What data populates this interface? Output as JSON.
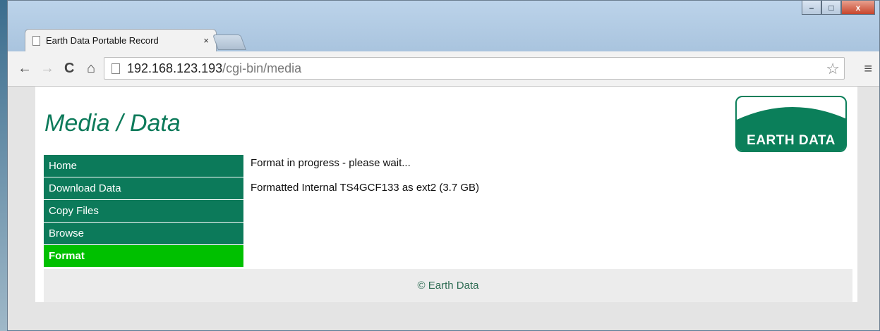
{
  "browser": {
    "tab_title": "Earth Data Portable Record",
    "tab_close": "×",
    "url_host": "192.168.123.193",
    "url_path": "/cgi-bin/media",
    "back_glyph": "←",
    "forward_glyph": "→",
    "reload_glyph": "C",
    "home_glyph": "⌂",
    "star_glyph": "☆",
    "menu_glyph": "≡",
    "minimize_glyph": "–",
    "maximize_glyph": "□",
    "close_glyph": "x"
  },
  "page": {
    "heading": "Media / Data",
    "logo_text": "EARTH DATA",
    "sidebar": [
      {
        "label": "Home",
        "active": false
      },
      {
        "label": "Download Data",
        "active": false
      },
      {
        "label": "Copy Files",
        "active": false
      },
      {
        "label": "Browse",
        "active": false
      },
      {
        "label": "Format",
        "active": true
      }
    ],
    "messages": [
      "Format in progress - please wait...",
      "Formatted Internal TS4GCF133 as ext2 (3.7 GB)"
    ],
    "footer": "© Earth Data"
  },
  "colors": {
    "brand_green": "#0c7a5a",
    "active_green": "#00c000",
    "footer_bg": "#ececec"
  }
}
